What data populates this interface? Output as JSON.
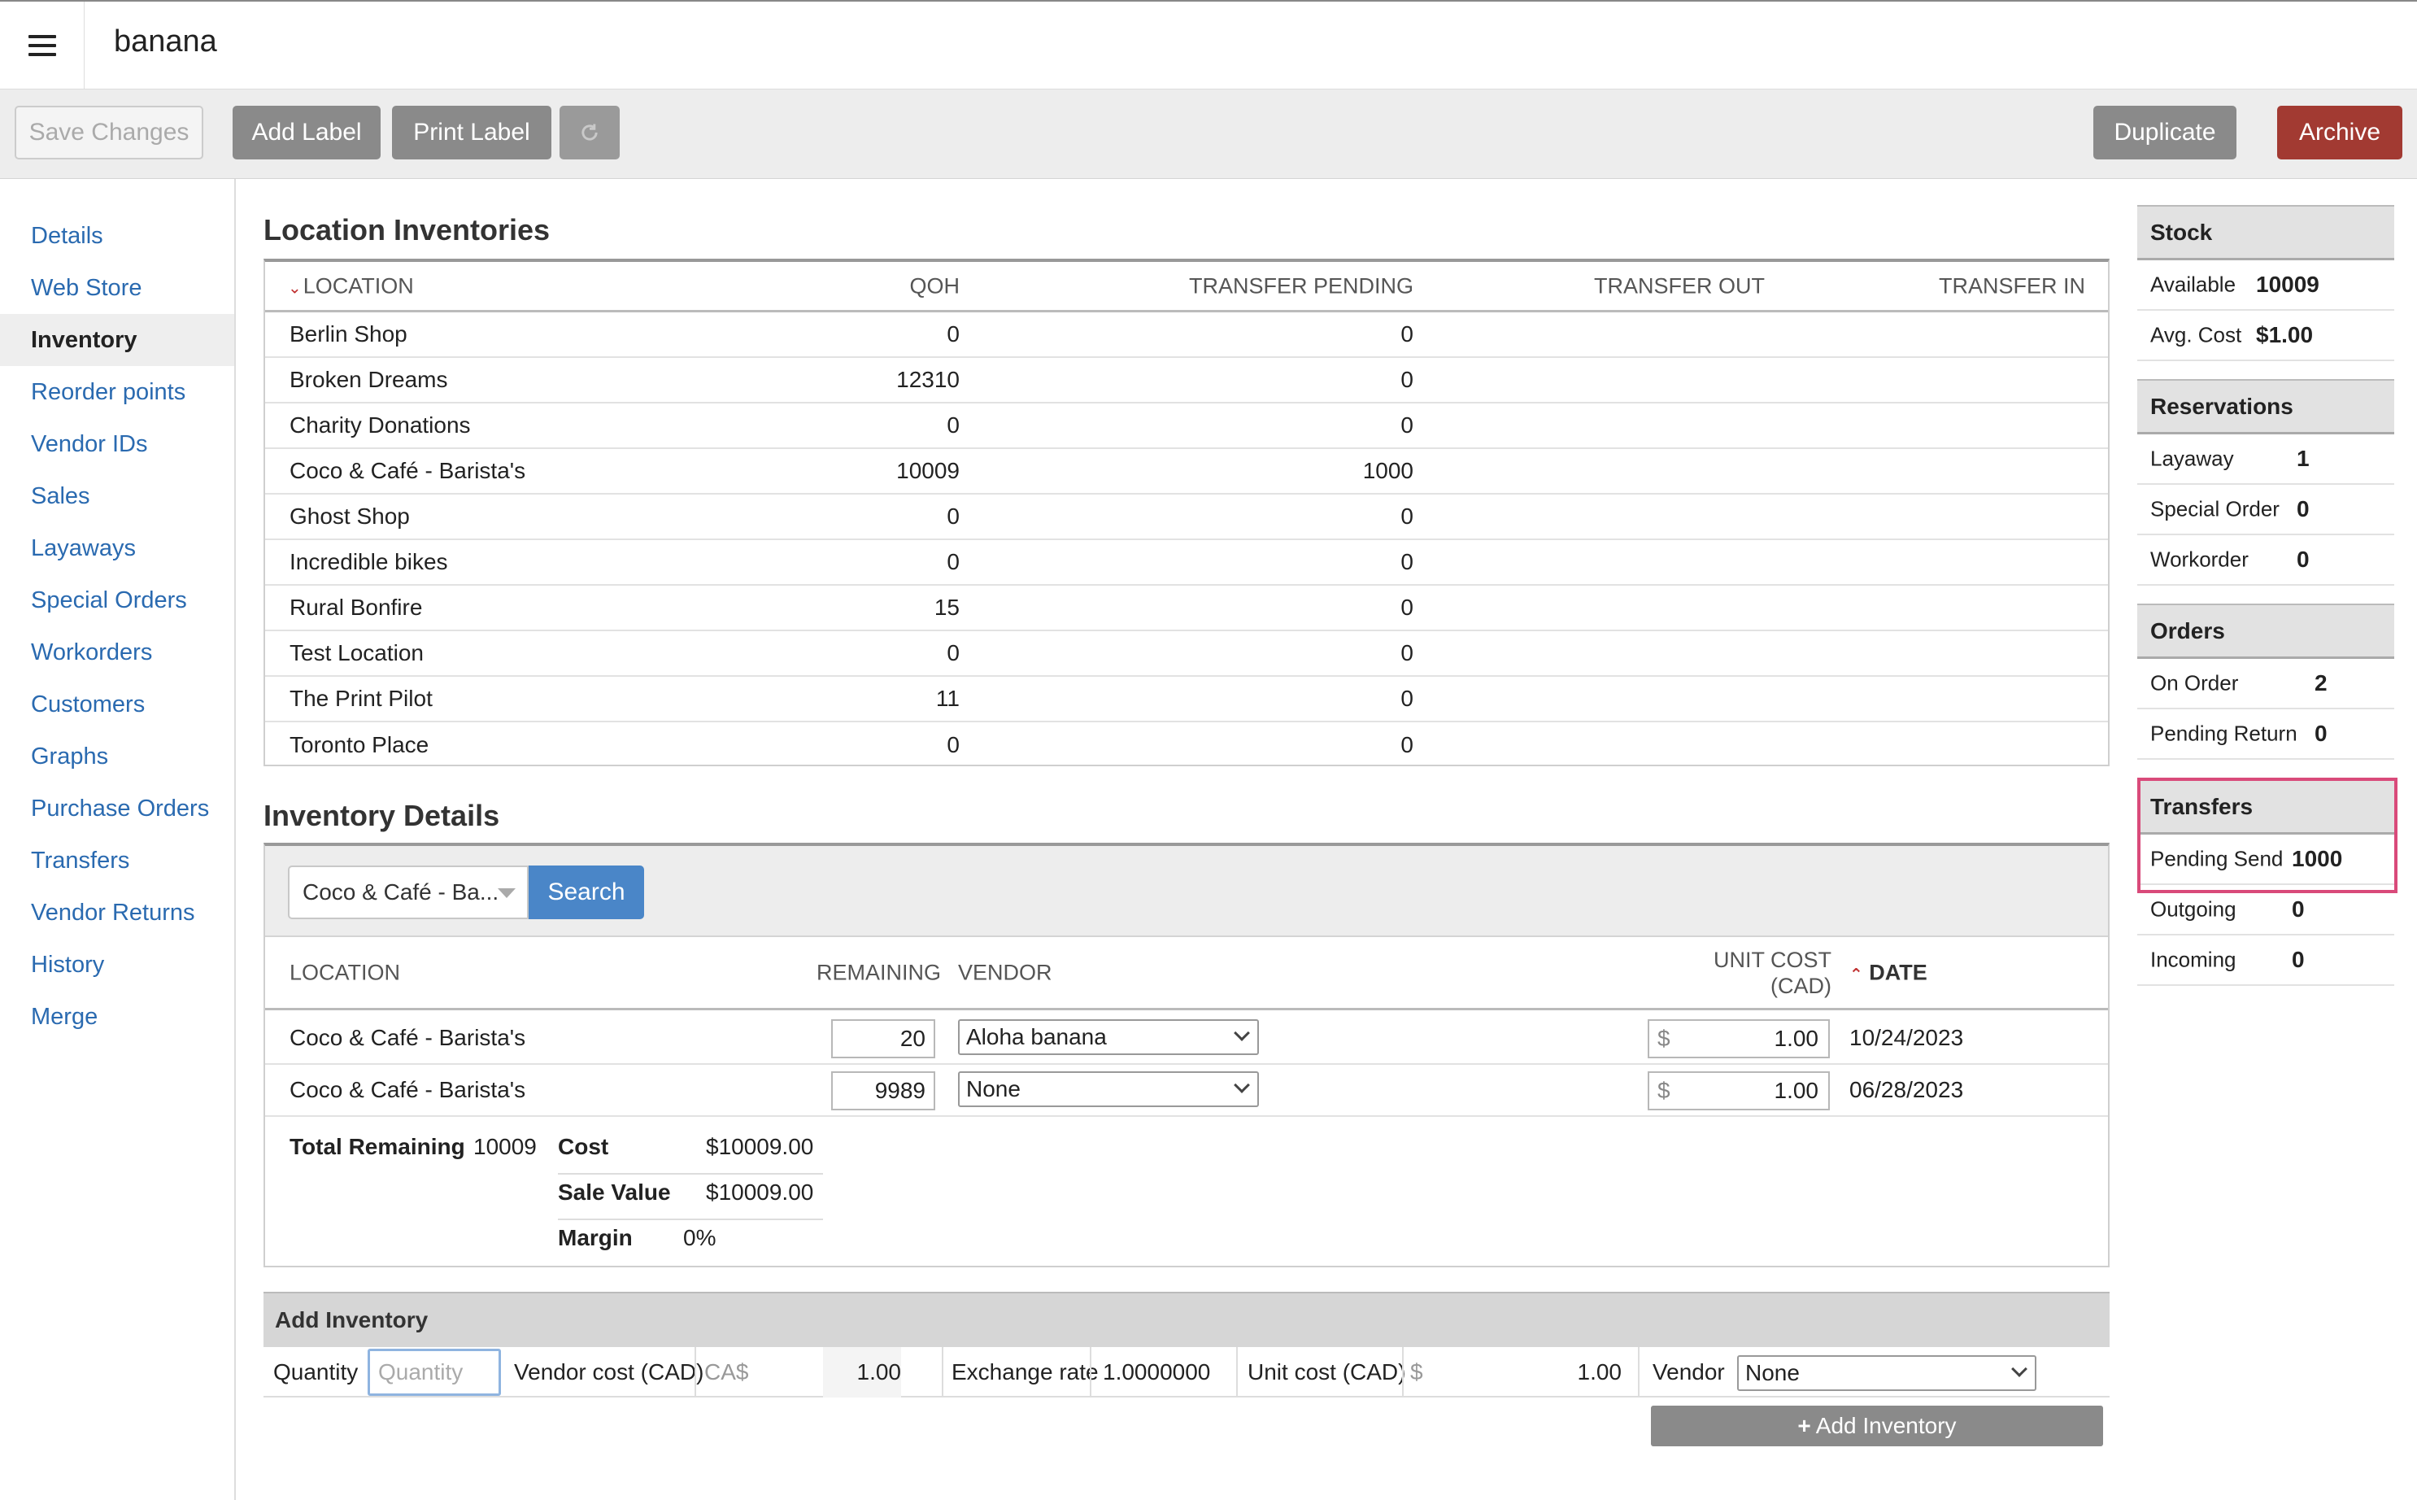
{
  "app": {
    "title": "banana"
  },
  "toolbar": {
    "save_label": "Save Changes",
    "add_label": "Add Label",
    "print_label": "Print Label",
    "refresh_icon": "refresh-icon",
    "duplicate_label": "Duplicate",
    "archive_label": "Archive"
  },
  "sidebar": {
    "items": [
      {
        "label": "Details",
        "active": false
      },
      {
        "label": "Web Store",
        "active": false
      },
      {
        "label": "Inventory",
        "active": true
      },
      {
        "label": "Reorder points",
        "active": false
      },
      {
        "label": "Vendor IDs",
        "active": false
      },
      {
        "label": "Sales",
        "active": false
      },
      {
        "label": "Layaways",
        "active": false
      },
      {
        "label": "Special Orders",
        "active": false
      },
      {
        "label": "Workorders",
        "active": false
      },
      {
        "label": "Customers",
        "active": false
      },
      {
        "label": "Graphs",
        "active": false
      },
      {
        "label": "Purchase Orders",
        "active": false
      },
      {
        "label": "Transfers",
        "active": false
      },
      {
        "label": "Vendor Returns",
        "active": false
      },
      {
        "label": "History",
        "active": false
      },
      {
        "label": "Merge",
        "active": false
      }
    ]
  },
  "location_inventories": {
    "title": "Location Inventories",
    "columns": [
      "LOCATION",
      "QOH",
      "TRANSFER PENDING",
      "TRANSFER OUT",
      "TRANSFER IN"
    ],
    "rows": [
      {
        "location": "Berlin Shop",
        "qoh": "0",
        "pending": "0"
      },
      {
        "location": "Broken Dreams",
        "qoh": "12310",
        "pending": "0"
      },
      {
        "location": "Charity Donations",
        "qoh": "0",
        "pending": "0"
      },
      {
        "location": "Coco & Café - Barista's",
        "qoh": "10009",
        "pending": "1000"
      },
      {
        "location": "Ghost Shop",
        "qoh": "0",
        "pending": "0"
      },
      {
        "location": "Incredible bikes",
        "qoh": "0",
        "pending": "0"
      },
      {
        "location": "Rural Bonfire",
        "qoh": "15",
        "pending": "0"
      },
      {
        "location": "Test Location",
        "qoh": "0",
        "pending": "0"
      },
      {
        "location": "The Print Pilot",
        "qoh": "11",
        "pending": "0"
      },
      {
        "location": "Toronto Place",
        "qoh": "0",
        "pending": "0"
      }
    ]
  },
  "inventory_details": {
    "title": "Inventory Details",
    "location_select": "Coco & Café - Ba...",
    "search_label": "Search",
    "columns": {
      "location": "LOCATION",
      "remaining": "REMAINING",
      "vendor": "VENDOR",
      "unit_cost_1": "UNIT COST",
      "unit_cost_2": "(CAD)",
      "date": "DATE"
    },
    "rows": [
      {
        "location": "Coco & Café - Barista's",
        "remaining": "20",
        "vendor": "Aloha banana",
        "currency": "$",
        "unit_cost": "1.00",
        "date": "10/24/2023"
      },
      {
        "location": "Coco & Café - Barista's",
        "remaining": "9989",
        "vendor": "None",
        "currency": "$",
        "unit_cost": "1.00",
        "date": "06/28/2023"
      }
    ],
    "totals": {
      "remaining_label": "Total Remaining",
      "remaining_value": "10009",
      "cost_label": "Cost",
      "cost_value": "$10009.00",
      "sale_label": "Sale Value",
      "sale_value": "$10009.00",
      "margin_label": "Margin",
      "margin_value": "0%"
    }
  },
  "add_inventory": {
    "title": "Add Inventory",
    "quantity_label": "Quantity",
    "quantity_placeholder": "Quantity",
    "vendor_cost_label": "Vendor cost (CAD)",
    "vendor_cost_prefix": "CA$",
    "vendor_cost_value": "1.00",
    "exchange_label": "Exchange rate",
    "exchange_value": "1.0000000",
    "unit_cost_label": "Unit cost (CAD)",
    "unit_cost_prefix": "$",
    "unit_cost_value": "1.00",
    "vendor_label": "Vendor",
    "vendor_value": "None",
    "button_label": "Add Inventory"
  },
  "panels": {
    "stock": {
      "title": "Stock",
      "available_label": "Available",
      "available_value": "10009",
      "avg_label": "Avg. Cost",
      "avg_value": "$1.00"
    },
    "reservations": {
      "title": "Reservations",
      "layaway_label": "Layaway",
      "layaway_value": "1",
      "special_label": "Special Order",
      "special_value": "0",
      "workorder_label": "Workorder",
      "workorder_value": "0"
    },
    "orders": {
      "title": "Orders",
      "on_order_label": "On Order",
      "on_order_value": "2",
      "pending_return_label": "Pending Return",
      "pending_return_value": "0"
    },
    "transfers": {
      "title": "Transfers",
      "pending_send_label": "Pending Send",
      "pending_send_value": "1000",
      "outgoing_label": "Outgoing",
      "outgoing_value": "0",
      "incoming_label": "Incoming",
      "incoming_value": "0"
    }
  },
  "colors": {
    "accent_blue": "#4a86c8",
    "archive_red": "#a23a32",
    "highlight_pink": "#d94a7a",
    "link_blue": "#2a6ab0"
  }
}
